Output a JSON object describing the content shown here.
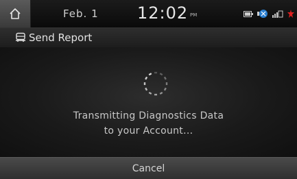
{
  "status_bar": {
    "date": "Feb. 1",
    "time": "12:02",
    "ampm": "PM",
    "icons": [
      "battery-icon",
      "phone-connection-icon",
      "signal-icon",
      "alert-icon"
    ]
  },
  "header": {
    "icon": "car-report-icon",
    "title": "Send Report"
  },
  "main": {
    "spinner_icon": "loading-spinner-icon",
    "message_line1": "Transmitting Diagnostics Data",
    "message_line2": "to your Account..."
  },
  "footer": {
    "cancel_label": "Cancel"
  },
  "colors": {
    "background": "#000000",
    "text": "#d8d8d8",
    "alert": "#e02020",
    "accent_blue": "#2a7fd0"
  }
}
